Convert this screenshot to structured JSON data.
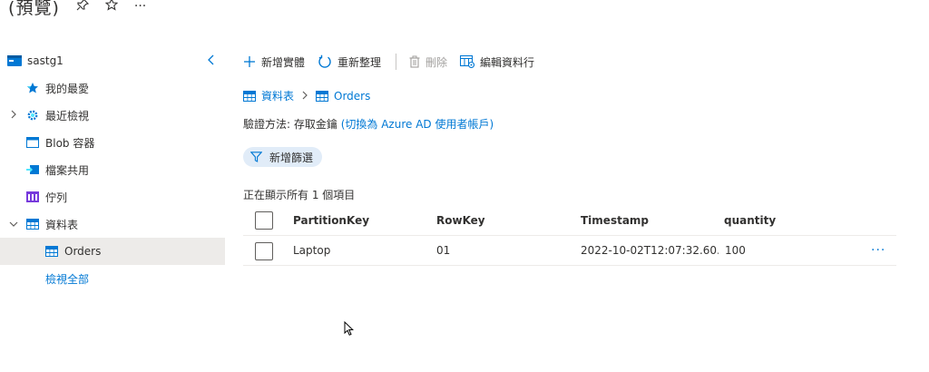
{
  "titlebar": {
    "title": "(預覽)",
    "pin_icon": "pin-icon",
    "star_icon": "star-icon",
    "more_label": "···"
  },
  "tree": {
    "account": "sastg1",
    "items": [
      {
        "label": "我的最愛",
        "icon": "star-icon"
      },
      {
        "label": "最近檢視",
        "icon": "gear-icon"
      },
      {
        "label": "Blob 容器",
        "icon": "blob-container-icon"
      },
      {
        "label": "檔案共用",
        "icon": "file-share-icon"
      },
      {
        "label": "佇列",
        "icon": "queue-icon"
      },
      {
        "label": "資料表",
        "icon": "table-icon"
      },
      {
        "label": "Orders",
        "icon": "table-icon"
      },
      {
        "label": "檢視全部"
      }
    ]
  },
  "toolbar": {
    "add_entity": "新增實體",
    "refresh": "重新整理",
    "delete": "刪除",
    "edit_columns": "編輯資料行"
  },
  "breadcrumb": {
    "root": "資料表",
    "current": "Orders"
  },
  "auth": {
    "label": "驗證方法:",
    "method": "存取金鑰",
    "switch_link": "(切換為 Azure AD 使用者帳戶)"
  },
  "filter": {
    "label": "新增篩選"
  },
  "showing": "正在顯示所有 1 個項目",
  "table": {
    "columns": [
      "PartitionKey",
      "RowKey",
      "Timestamp",
      "quantity"
    ],
    "rows": [
      {
        "PartitionKey": "Laptop",
        "RowKey": "01",
        "Timestamp": "2022-10-02T12:07:32.60...",
        "quantity": "100",
        "more": "···"
      }
    ]
  },
  "colors": {
    "accent": "#0078d4",
    "selected_bg": "#edebe9",
    "pill_bg": "#e1ecf8"
  }
}
